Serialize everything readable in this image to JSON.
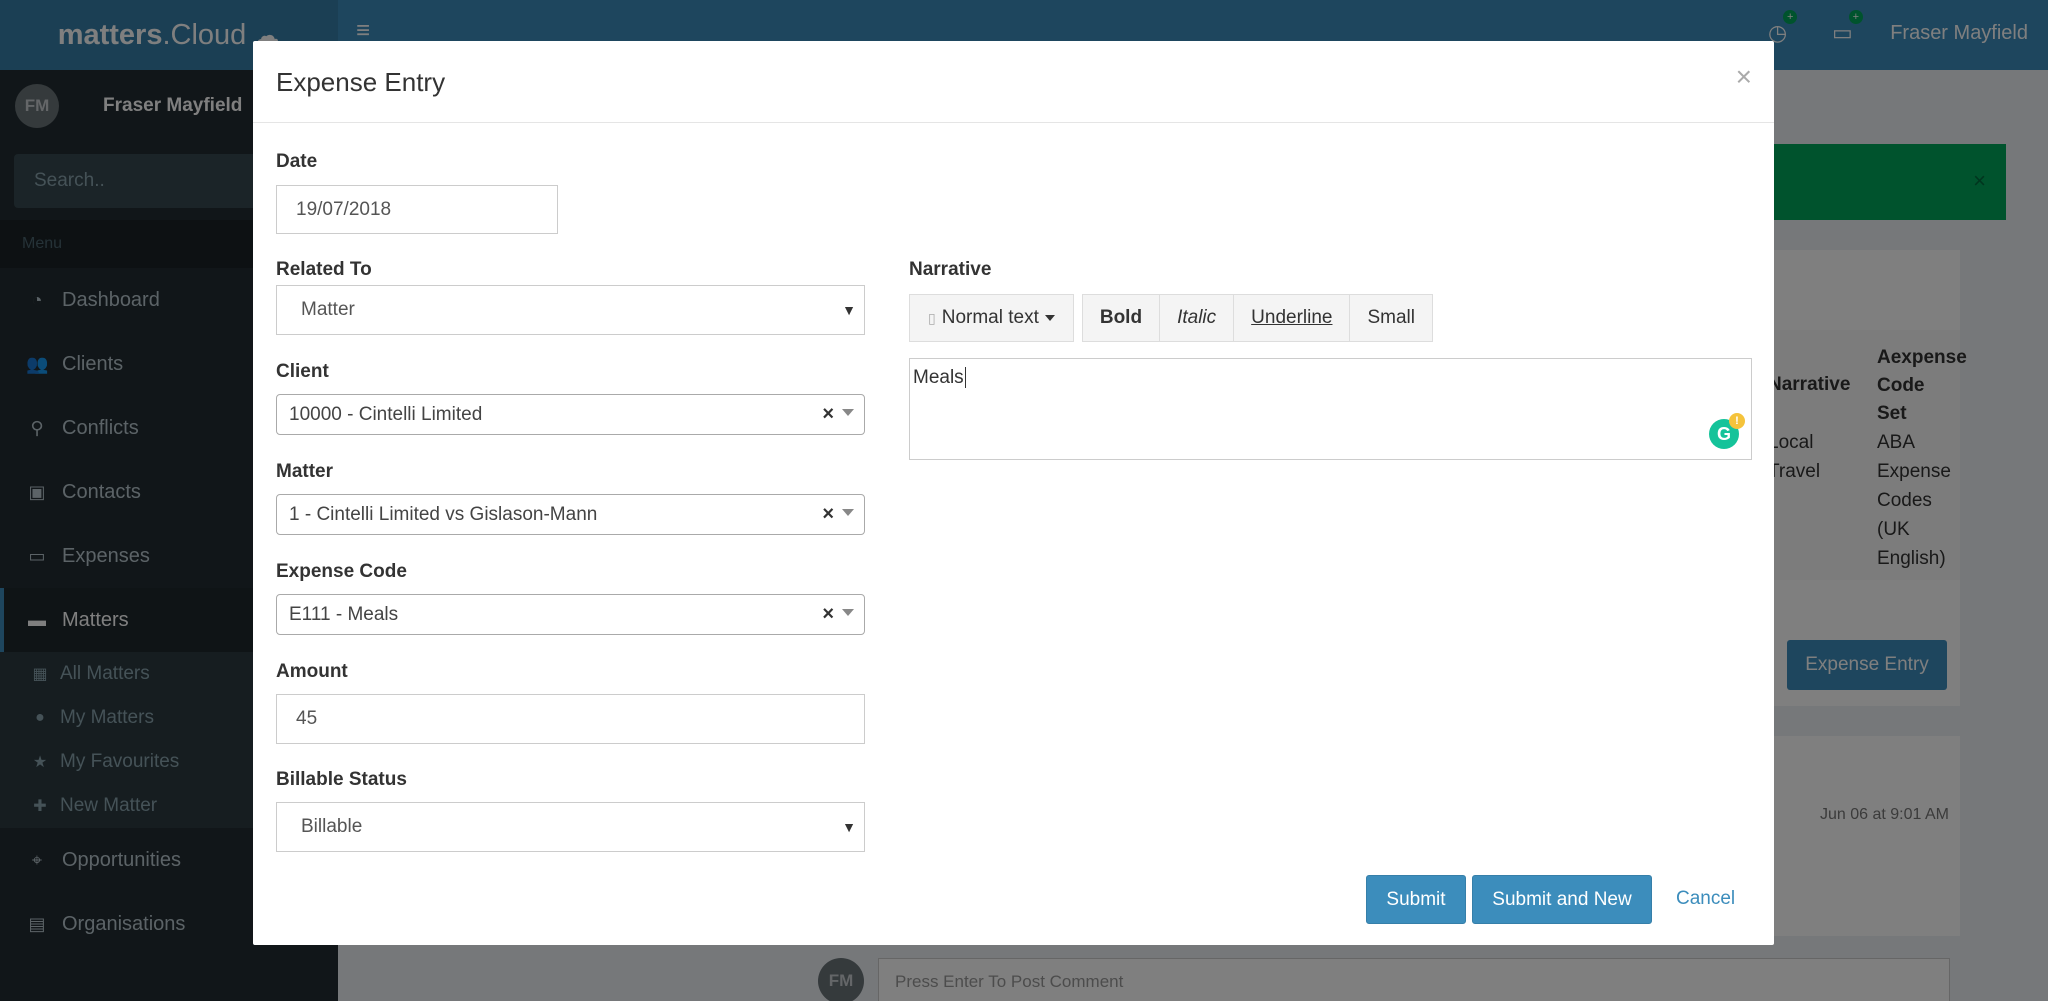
{
  "topbar": {
    "logo_bold": "matters",
    "logo_rest": ".Cloud",
    "user_name": "Fraser Mayfield"
  },
  "sidebar": {
    "user_initials": "FM",
    "user_name": "Fraser Mayfield",
    "search_placeholder": "Search..",
    "menu_header": "Menu",
    "items": [
      {
        "label": "Dashboard",
        "icon": "dashboard-icon"
      },
      {
        "label": "Clients",
        "icon": "users-icon"
      },
      {
        "label": "Conflicts",
        "icon": "search-icon"
      },
      {
        "label": "Contacts",
        "icon": "address-card-icon"
      },
      {
        "label": "Expenses",
        "icon": "credit-card-icon"
      },
      {
        "label": "Matters",
        "icon": "folder-icon"
      }
    ],
    "sub_items": [
      {
        "label": "All Matters",
        "icon": "table-icon"
      },
      {
        "label": "My Matters",
        "icon": "user-icon"
      },
      {
        "label": "My Favourites",
        "icon": "star-icon"
      },
      {
        "label": "New Matter",
        "icon": "plus-icon"
      }
    ],
    "items_after": [
      {
        "label": "Opportunities",
        "icon": "crosshairs-icon"
      },
      {
        "label": "Organisations",
        "icon": "building-icon"
      }
    ]
  },
  "background": {
    "table_headers": [
      "Narrative",
      "Aexpense Code Set"
    ],
    "row": [
      "Local Travel",
      "ABA Expense Codes (UK English)"
    ],
    "expense_entry_button": "Expense Entry",
    "comment_date": "Jun 06 at 9:01 AM",
    "comment_initials": "FM",
    "comment_placeholder": "Press Enter To Post Comment"
  },
  "modal": {
    "title": "Expense Entry",
    "close": "×",
    "date": {
      "label": "Date",
      "value": "19/07/2018"
    },
    "related_to": {
      "label": "Related To",
      "value": "Matter"
    },
    "client": {
      "label": "Client",
      "value": "10000 - Cintelli Limited"
    },
    "matter": {
      "label": "Matter",
      "value": "1 - Cintelli Limited vs Gislason-Mann"
    },
    "expense_code": {
      "label": "Expense Code",
      "value": "E111 - Meals"
    },
    "amount": {
      "label": "Amount",
      "value": "45"
    },
    "billable_status": {
      "label": "Billable Status",
      "value": "Billable"
    },
    "narrative": {
      "label": "Narrative",
      "toolbar": {
        "style": "Normal text",
        "bold": "Bold",
        "italic": "Italic",
        "underline": "Underline",
        "small": "Small"
      },
      "value": "Meals"
    },
    "buttons": {
      "submit": "Submit",
      "submit_new": "Submit and New",
      "cancel": "Cancel"
    }
  }
}
